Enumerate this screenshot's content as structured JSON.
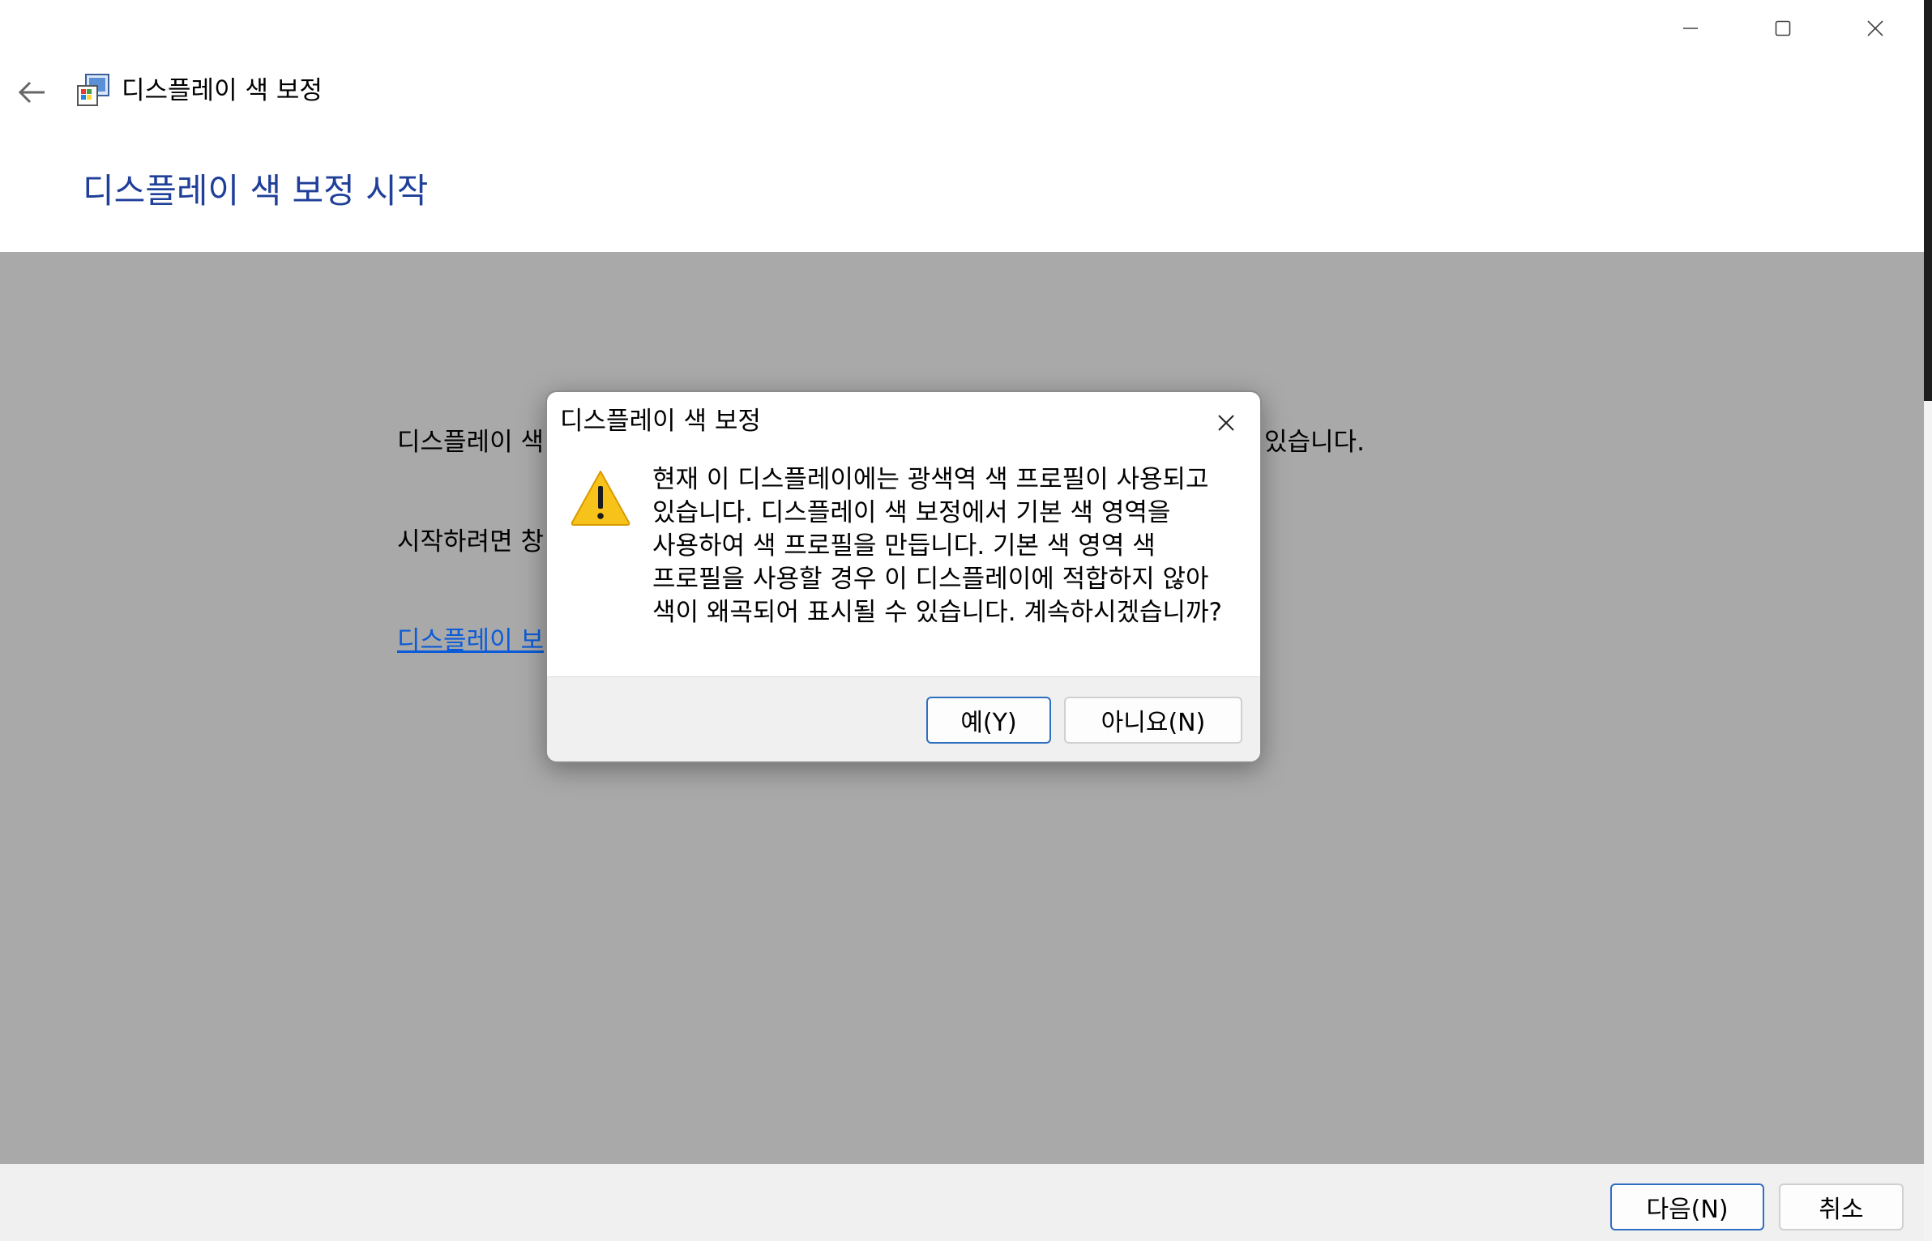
{
  "window": {
    "app_title": "디스플레이 색 보정",
    "page_heading": "디스플레이 색 보정 시작",
    "caption_icons": [
      "minimize-icon",
      "maximize-icon",
      "close-icon"
    ]
  },
  "content": {
    "line1_start": "디스플레이 색",
    "line1_end": "있습니다.",
    "line2_start": "시작하려면 창",
    "link_text": "디스플레이 보"
  },
  "footer": {
    "next_label": "다음(N)",
    "cancel_label": "취소"
  },
  "dialog": {
    "title": "디스플레이 색 보정",
    "message": "현재 이 디스플레이에는 광색역 색 프로필이 사용되고 있습니다. 디스플레이 색 보정에서 기본 색 영역을 사용하여 색 프로필을 만듭니다. 기본 색 영역 색 프로필을 사용할 경우 이 디스플레이에 적합하지 않아 색이 왜곡되어 표시될 수 있습니다. 계속하시겠습니까?",
    "yes_label": "예(Y)",
    "no_label": "아니요(N)",
    "icon": "warning-icon"
  },
  "colors": {
    "heading": "#1f3f99",
    "link": "#0b5bd8",
    "overlay_gray": "#a9a9a9",
    "warning_yellow": "#f7c21a"
  }
}
